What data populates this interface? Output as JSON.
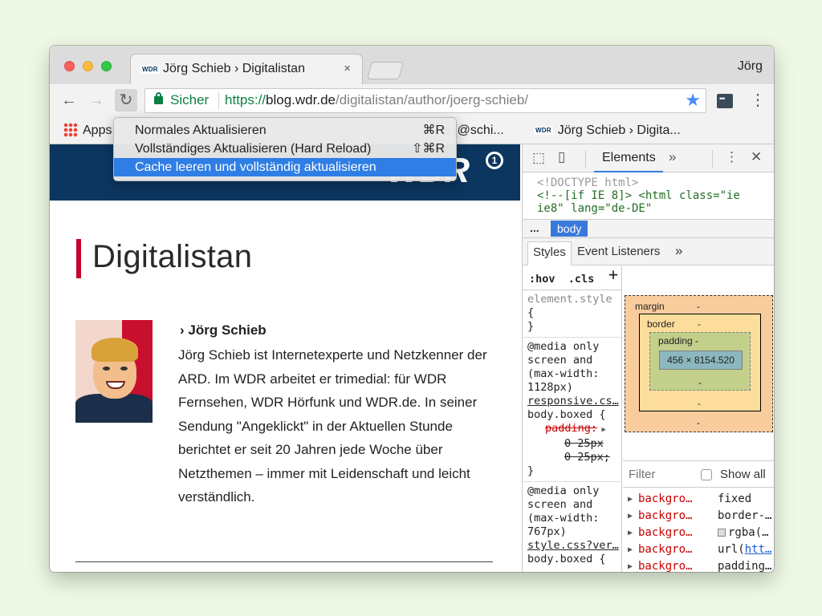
{
  "window": {
    "tab_title": "Jörg Schieb › Digitalistan",
    "tab_close": "×",
    "favicon_text": "WDR",
    "profile_name": "Jörg"
  },
  "toolbar": {
    "back_icon": "←",
    "forward_icon": "→",
    "reload_icon": "↻",
    "security_label": "Sicher",
    "url_scheme": "https://",
    "url_host": "blog.wdr.de",
    "url_path": "/digitalistan/author/joerg-schieb/",
    "star_icon": "★",
    "menu_icon": "⋮"
  },
  "bookmarks": {
    "apps_label": "Apps",
    "item2_label": "b (@schi...",
    "item3_label": "Jörg Schieb › Digita..."
  },
  "context_menu": {
    "items": [
      {
        "label": "Normales Aktualisieren",
        "shortcut": "⌘R"
      },
      {
        "label": "Vollständiges Aktualisieren (Hard Reload)",
        "shortcut": "⇧⌘R"
      },
      {
        "label": "Cache leeren und vollständig aktualisieren",
        "shortcut": ""
      }
    ],
    "selected_index": 2
  },
  "page": {
    "logo": "WDR",
    "logo_sup": "1",
    "title": "Digitalistan",
    "author_name": "› Jörg Schieb",
    "bio": "Jörg Schieb ist Internetexperte und Netzkenner der ARD. Im WDR arbeitet er trimedial: für WDR Fernsehen, WDR Hörfunk und WDR.de. In seiner Sendung \"Angeklickt\" in der Aktuellen Stunde berichtet er seit 20 Jahren jede Woche über Netzthemen – immer mit Leidenschaft und leicht verständlich."
  },
  "devtools": {
    "tab_elements": "Elements",
    "more_tabs": "»",
    "close": "✕",
    "dom_doctype": "<!DOCTYPE html>",
    "dom_line1": "<!--[if IE 8]> <html class=\"ie",
    "dom_line2": "ie8\" lang=\"de-DE\"",
    "crumb_dots": "...",
    "crumb_body": "body",
    "subtab_styles": "Styles",
    "subtab_listeners": "Event Listeners",
    "subtab_more": "»",
    "hov": ":hov",
    "cls": ".cls",
    "plus": "+",
    "element_style": [
      "element.style",
      "{",
      "}"
    ],
    "rule1": {
      "media": [
        "@media only",
        "screen and",
        "(max-width:",
        "1128px)"
      ],
      "source": "responsive.cs…",
      "selector": "body.boxed {",
      "prop": "padding:",
      "vals": [
        "0 25px",
        "0 25px;"
      ],
      "close": "}"
    },
    "rule2": {
      "media": [
        "@media only",
        "screen and",
        "(max-width:",
        "767px)"
      ],
      "source": "style.css?ver…",
      "selector": "body.boxed {"
    },
    "box_model": {
      "margin_label": "margin",
      "border_label": "border",
      "padding_label": "padding -",
      "content_size": "456 × 8154.520",
      "dash": "-"
    },
    "filter_placeholder": "Filter",
    "show_all": "Show all",
    "computed": [
      {
        "name": "backgro…",
        "value": "fixed"
      },
      {
        "name": "backgro…",
        "value": "border-…"
      },
      {
        "name": "backgro…",
        "value": "rgba(…"
      },
      {
        "name": "backgro…",
        "value_prefix": "url(",
        "value_link": "htt…"
      },
      {
        "name": "backgro…",
        "value": "padding…"
      }
    ]
  },
  "colors": {
    "wdr_blue": "#0c3660",
    "accent_red": "#c4002f",
    "menu_highlight": "#2f7ee5",
    "secure_green": "#0b8043",
    "devtools_blue": "#3879d9"
  }
}
